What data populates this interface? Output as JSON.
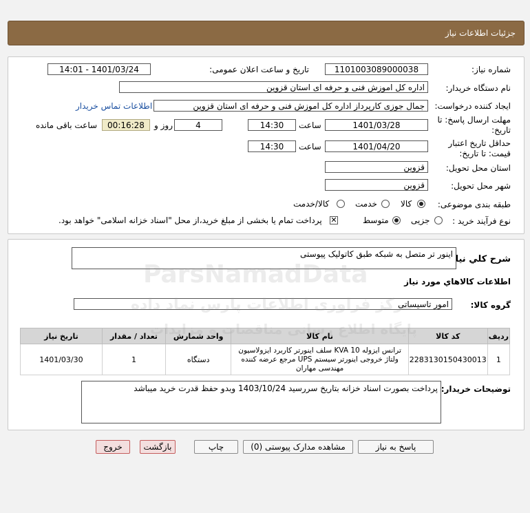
{
  "header": {
    "title": "جزئیات اطلاعات نیاز"
  },
  "form": {
    "need_number_label": "شماره نیاز:",
    "need_number": "1101003089000038",
    "announce_label": "تاریخ و ساعت اعلان عمومی:",
    "announce_value": "1401/03/24 - 14:01",
    "buyer_org_label": "نام دستگاه خریدار:",
    "buyer_org": "اداره کل اموزش فنی و حرفه ای استان قزوین",
    "creator_label": "ایجاد کننده درخواست:",
    "creator": "جمال جوزی کارپرداز اداره کل اموزش فنی و حرفه ای استان قزوین",
    "contact_link": "اطلاعات تماس خریدار",
    "deadline_label_1": "مهلت ارسال پاسخ: تا",
    "deadline_label_2": "تاریخ:",
    "deadline_date": "1401/03/28",
    "time_label": "ساعت",
    "deadline_time": "14:30",
    "days_value": "4",
    "days_label": "روز و",
    "remaining_time": "00:16:28",
    "remaining_label": "ساعت باقی مانده",
    "validity_label_1": "حداقل تاریخ اعتبار",
    "validity_label_2": "قیمت: تا تاریخ:",
    "validity_date": "1401/04/20",
    "validity_time": "14:30",
    "province_label": "استان محل تحویل:",
    "province": "قزوین",
    "city_label": "شهر محل تحویل:",
    "city": "قزوین",
    "category_label": "طبقه بندی موضوعی:",
    "category_goods": "کالا",
    "category_service": "خدمت",
    "category_both": "کالا/خدمت",
    "process_label": "نوع فرآیند خرید :",
    "process_partial": "جزیی",
    "process_medium": "متوسط",
    "treasury_note": "پرداخت تمام یا بخشی از مبلغ خرید،از محل \"اسناد خزانه اسلامی\" خواهد بود."
  },
  "summary": {
    "label": "شرح کلي نياز:",
    "value": "اینور تر متصل به شبکه طبق کاتولیک پیوستی"
  },
  "goods_section": {
    "title": "اطلاعات کالاهاي مورد نياز",
    "group_label": "گروه کالا:",
    "group_value": "امور تاسیساتی"
  },
  "table": {
    "headers": [
      "ردیف",
      "کد کالا",
      "نام کالا",
      "واحد شمارش",
      "تعداد / مقدار",
      "تاریخ نیاز"
    ],
    "rows": [
      {
        "row": "1",
        "code": "2283130150430013",
        "name": "ترانس ایزوله KVA 10 سلف اینورتر کاربرد ایزولاسیون ولتاژ خروجی اینورتر سیستم UPS مرجع عرضه کننده مهندسی مهاران",
        "unit": "دستگاه",
        "qty": "1",
        "date": "1401/03/30"
      }
    ]
  },
  "buyer_notes": {
    "label": "توضیحات خریدار:",
    "value": "پرداخت بصورت اسناد خزانه بتاریخ سررسید 1403/10/24 وبدو حفظ قدرت خرید میباشد"
  },
  "buttons": {
    "reply": "پاسخ به نیاز",
    "view_docs": "مشاهده مدارک پیوستی (0)",
    "print": "چاپ",
    "back": "بازگشت",
    "exit": "خروج"
  },
  "watermark": {
    "brand": "ParsNamadData",
    "line1": "مرکز فراوری اطلاعات پارس نماد داده",
    "line2": "پایگاه اطلاع رسانی مناقصات و مزایدات"
  }
}
